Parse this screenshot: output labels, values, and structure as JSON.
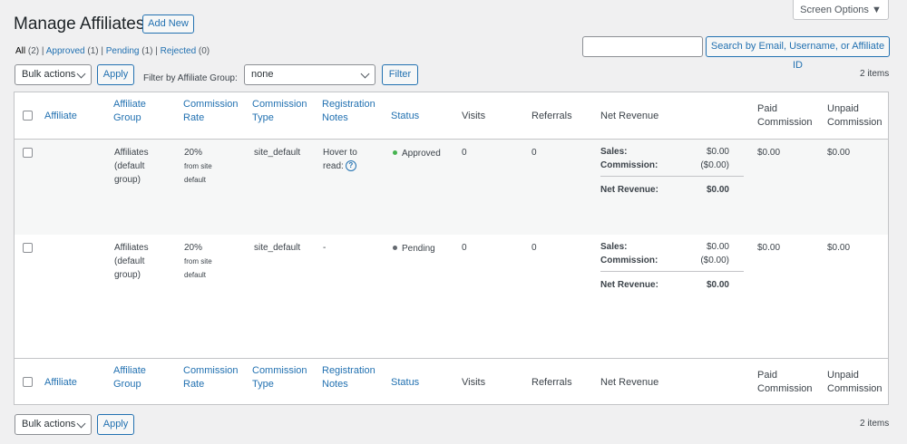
{
  "screen_options": "Screen Options ▼",
  "page_title": "Manage Affiliates",
  "add_new": "Add New",
  "filters": {
    "all": "All",
    "all_count": "(2)",
    "approved": "Approved",
    "approved_count": "(1)",
    "pending": "Pending",
    "pending_count": "(1)",
    "rejected": "Rejected",
    "rejected_count": "(0)",
    "sep": "|"
  },
  "search": {
    "value": "",
    "button": "Search by Email, Username, or Affiliate ID"
  },
  "bulk": {
    "label": "Bulk actions",
    "apply": "Apply"
  },
  "group_filter": {
    "label": "Filter by Affiliate Group:",
    "value": "none",
    "button": "Filter"
  },
  "items_count": "2 items",
  "columns": {
    "affiliate": "Affiliate",
    "group_1": "Affiliate",
    "group_2": "Group",
    "rate_1": "Commission",
    "rate_2": "Rate",
    "type_1": "Commission",
    "type_2": "Type",
    "notes_1": "Registration",
    "notes_2": "Notes",
    "status": "Status",
    "visits": "Visits",
    "referrals": "Referrals",
    "net_revenue": "Net Revenue",
    "paid_1": "Paid",
    "paid_2": "Commission",
    "unpaid_1": "Unpaid",
    "unpaid_2": "Commission"
  },
  "rows": [
    {
      "group_1": "Affiliates",
      "group_2": "(default",
      "group_3": "group)",
      "rate": "20%",
      "rate_sub_1": "from site",
      "rate_sub_2": "default",
      "type": "site_default",
      "notes_1": "Hover to",
      "notes_2": "read:",
      "status": "Approved",
      "status_color": "#46b450",
      "visits": "0",
      "referrals": "0",
      "sales_label": "Sales:",
      "sales": "$0.00",
      "commission_label": "Commission:",
      "commission": "($0.00)",
      "net_label": "Net Revenue:",
      "net": "$0.00",
      "paid": "$0.00",
      "unpaid": "$0.00"
    },
    {
      "group_1": "Affiliates",
      "group_2": "(default",
      "group_3": "group)",
      "rate": "20%",
      "rate_sub_1": "from site",
      "rate_sub_2": "default",
      "type": "site_default",
      "notes_1": "-",
      "notes_2": "",
      "status": "Pending",
      "status_color": "#646970",
      "visits": "0",
      "referrals": "0",
      "sales_label": "Sales:",
      "sales": "$0.00",
      "commission_label": "Commission:",
      "commission": "($0.00)",
      "net_label": "Net Revenue:",
      "net": "$0.00",
      "paid": "$0.00",
      "unpaid": "$0.00"
    }
  ]
}
